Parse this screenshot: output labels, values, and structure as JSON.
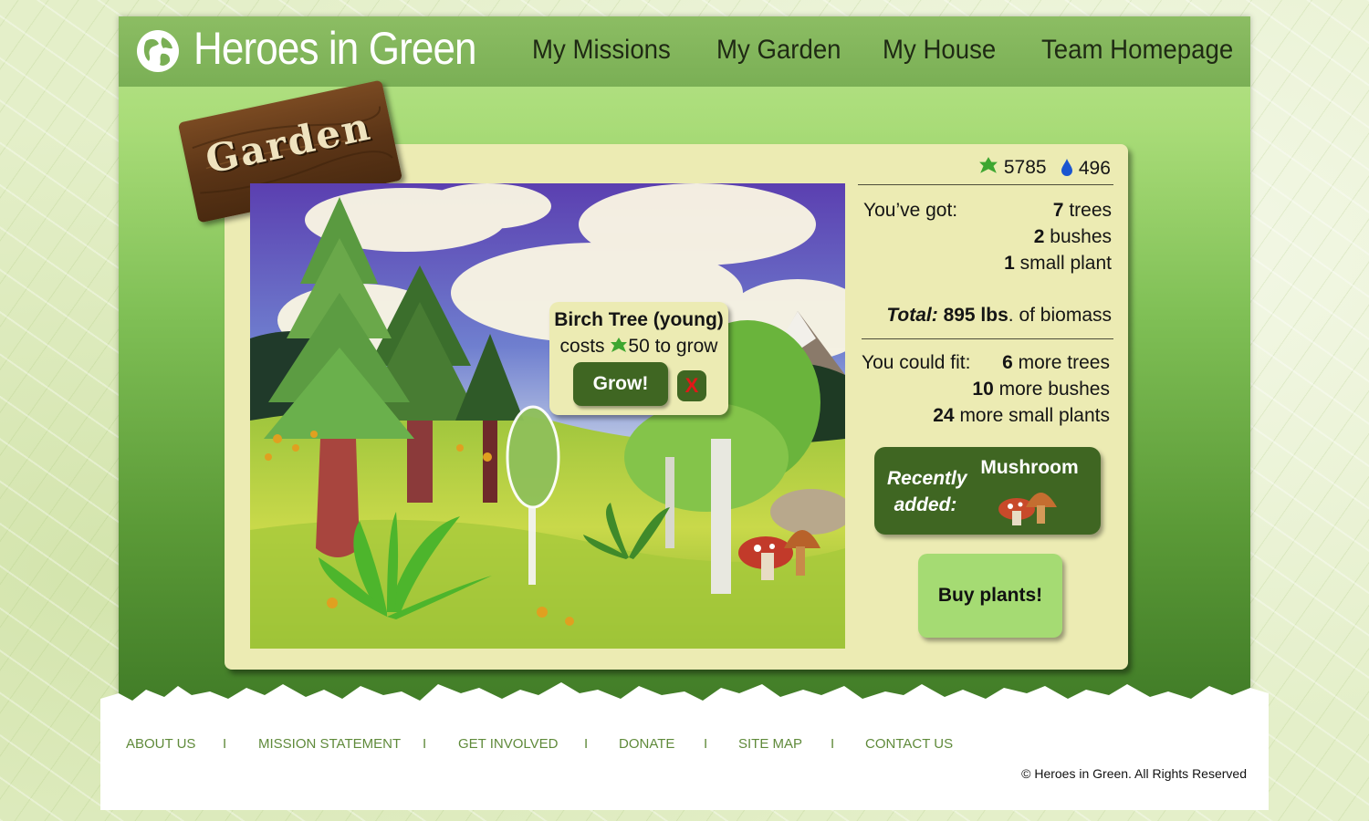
{
  "header": {
    "logo_text": "Heroes in Green",
    "nav": [
      "My Missions",
      "My Garden",
      "My House",
      "Team Homepage"
    ]
  },
  "garden_sign": "Garden",
  "currencies": {
    "leaves": "5785",
    "water": "496"
  },
  "popup": {
    "title": "Birch Tree (young)",
    "cost_prefix": "costs",
    "cost_value": "50 to grow",
    "grow_label": "Grow!",
    "close_label": "X"
  },
  "stats": {
    "got_label": "You’ve got:",
    "got": [
      {
        "count": "7",
        "label": "trees"
      },
      {
        "count": "2",
        "label": "bushes"
      },
      {
        "count": "1",
        "label": "small plant"
      }
    ],
    "total_label": "Total:",
    "total_value": "895 lbs",
    "total_suffix": ". of biomass",
    "fit_label": "You could fit:",
    "fit": [
      {
        "count": "6",
        "label": "more trees"
      },
      {
        "count": "10",
        "label": "more bushes"
      },
      {
        "count": "24",
        "label": "more small plants"
      }
    ]
  },
  "recent": {
    "label_line1": "Recently",
    "label_line2": "added:",
    "item": "Mushroom"
  },
  "buy_label": "Buy plants!",
  "footer": {
    "links": [
      "ABOUT US",
      "MISSION STATEMENT",
      "GET INVOLVED",
      "DONATE",
      "SITE MAP",
      "CONTACT US"
    ],
    "separator": "I",
    "copyright": "© Heroes in Green.  All Rights Reserved"
  },
  "colors": {
    "dark_green": "#3f6622",
    "panel": "#ecebb3",
    "light_green": "#a5db73",
    "footer_link": "#5f8a3a"
  }
}
